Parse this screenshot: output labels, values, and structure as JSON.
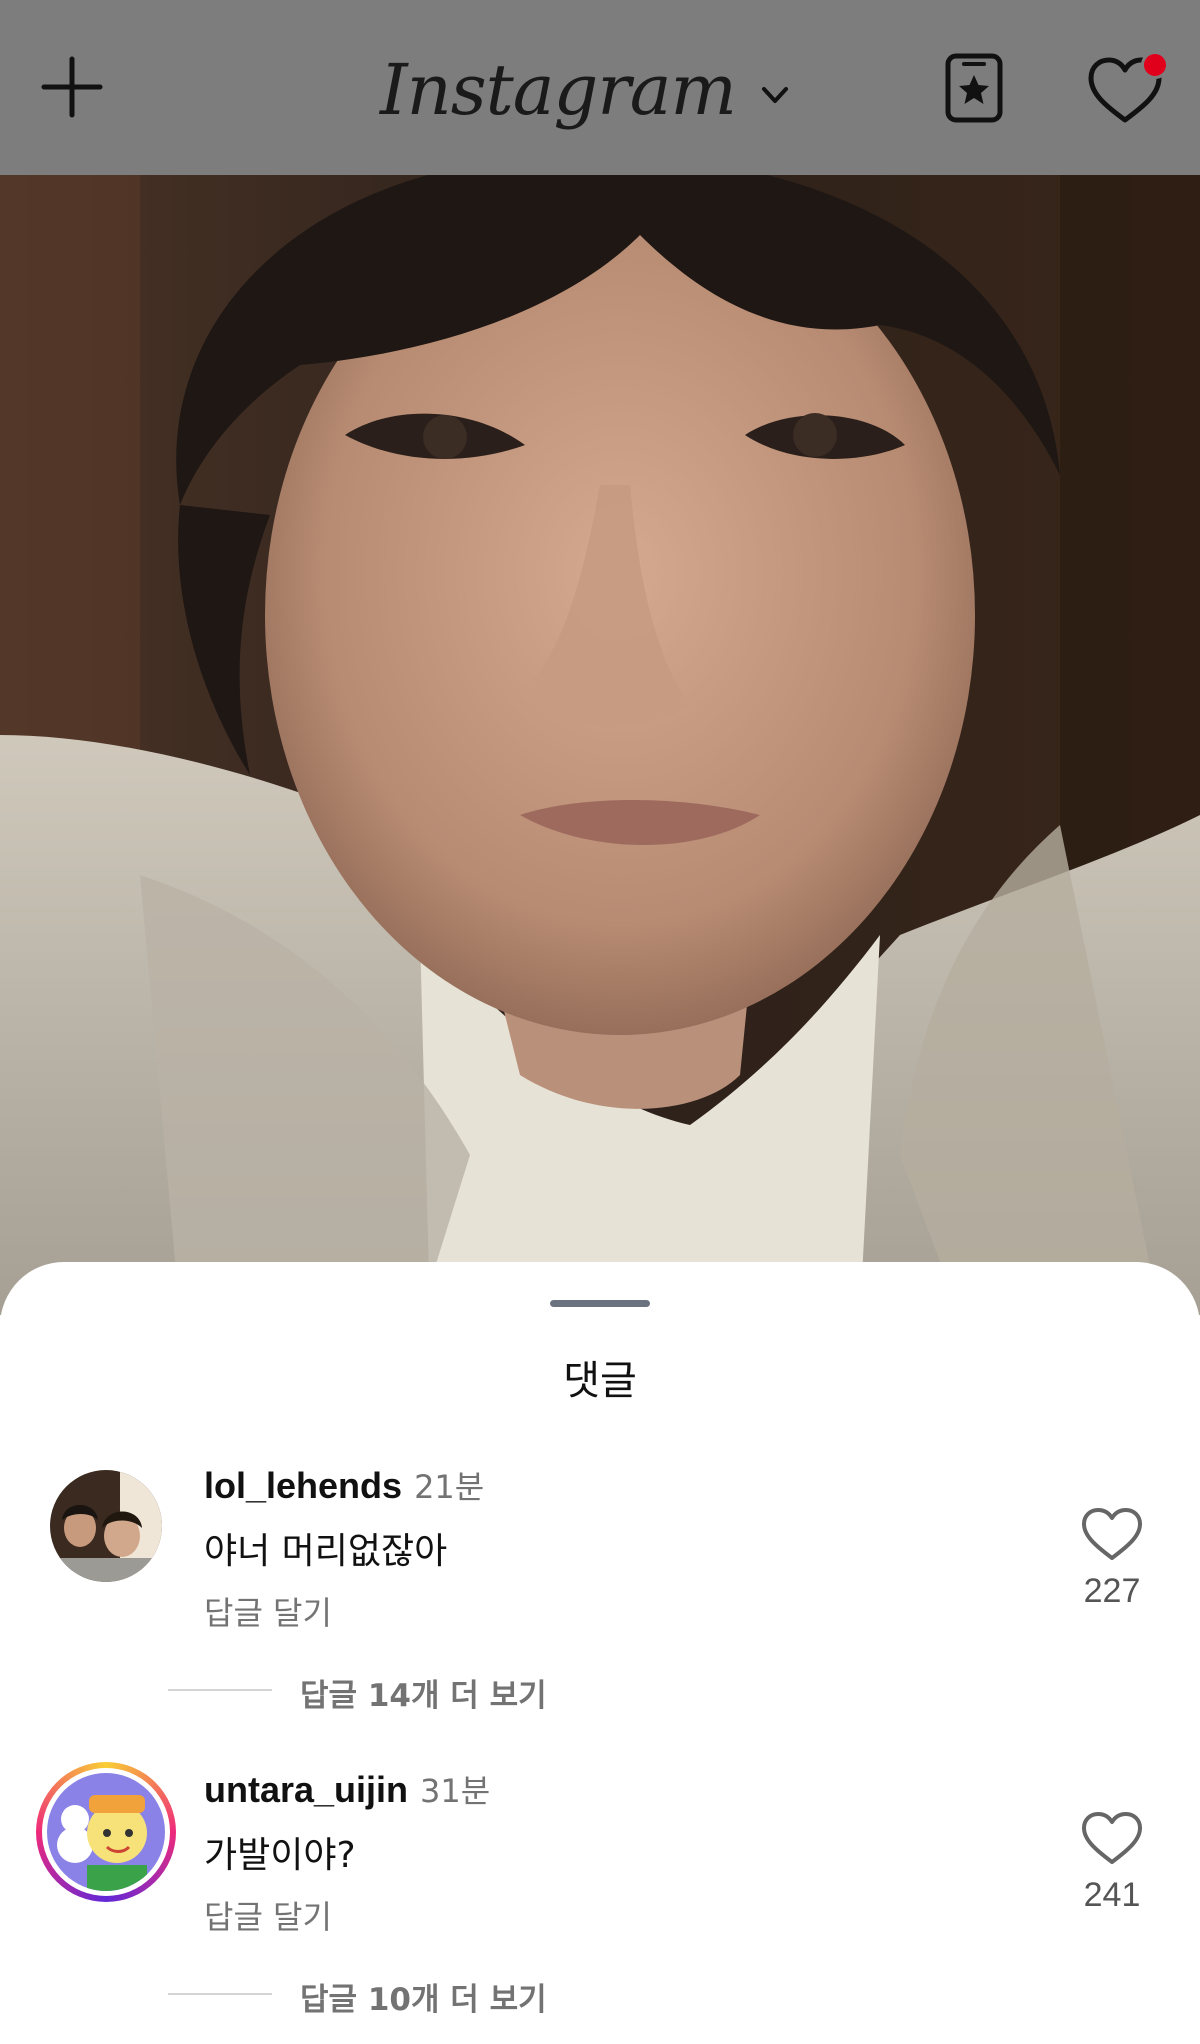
{
  "topbar": {
    "logo": "Instagram",
    "icons": [
      "plus-icon",
      "chevron-down-icon",
      "favorites-icon",
      "heart-icon"
    ],
    "notification_dot_color": "#e0001b",
    "background": "#7d7d7d"
  },
  "post": {
    "image": "selfie-photo"
  },
  "comments_sheet": {
    "title": "댓글",
    "comments": [
      {
        "username": "lol_lehends",
        "time": "21분",
        "text": "야너 머리없잖아",
        "reply_label": "답글 달기",
        "likes": "227",
        "more_replies": "답글 14개 더 보기"
      },
      {
        "username": "untara_uijin",
        "time": "31분",
        "text": "가발이야?",
        "reply_label": "답글 달기",
        "likes": "241",
        "more_replies": "답글 10개 더 보기"
      }
    ]
  }
}
